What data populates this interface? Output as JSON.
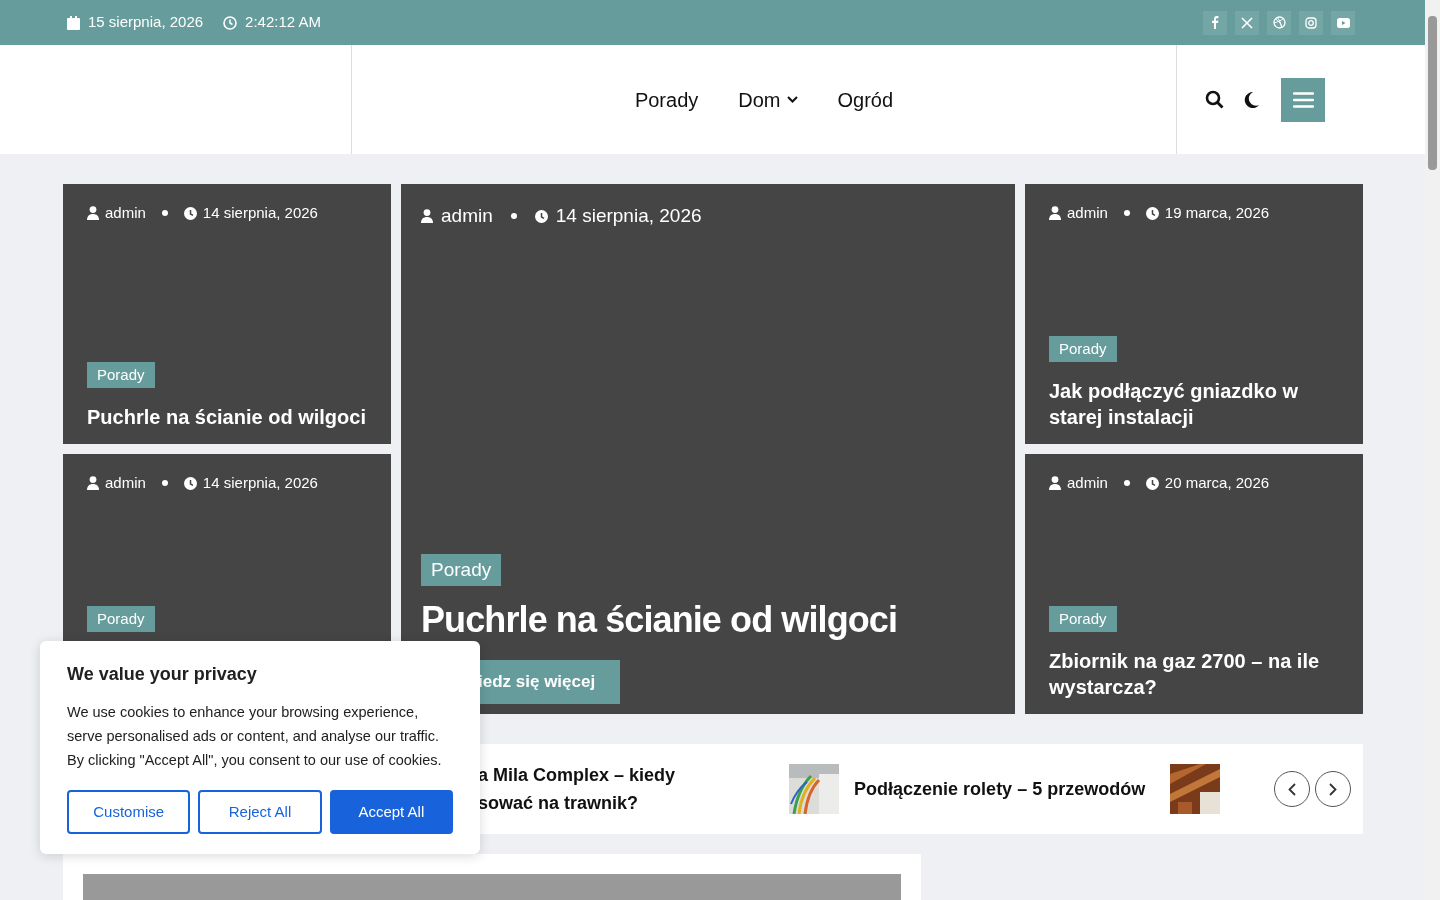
{
  "topbar": {
    "date": "15 sierpnia, 2026",
    "time": "2:42:12 AM"
  },
  "nav": [
    {
      "label": "Porady",
      "dropdown": false
    },
    {
      "label": "Dom",
      "dropdown": true
    },
    {
      "label": "Ogród",
      "dropdown": false
    }
  ],
  "cards": [
    {
      "kind": "small",
      "author": "admin",
      "date": "14 sierpnia, 2026",
      "category": "Porady",
      "title": "Puchrle na ścianie od wilgoci"
    },
    {
      "kind": "featured",
      "author": "admin",
      "date": "14 sierpnia, 2026",
      "category": "Porady",
      "title": "Puchrle na ścianie od wilgoci",
      "button": "iedz się więcej"
    },
    {
      "kind": "small",
      "author": "admin",
      "date": "19 marca, 2026",
      "category": "Porady",
      "title": "Jak podłączyć gniazdko w starej instalacji"
    },
    {
      "kind": "small",
      "author": "admin",
      "date": "14 sierpnia, 2026",
      "category": "Porady"
    },
    {
      "kind": "small",
      "author": "admin",
      "date": "20 marca, 2026",
      "category": "Porady",
      "title": "Zbiornik na gaz 2700 – na ile wystarcza?"
    }
  ],
  "ticker": [
    {
      "title_lines": [
        "a Mila Complex – kiedy",
        "sować na trawnik?"
      ]
    },
    {
      "kind": "picture",
      "title_lines": [
        "Podłączenie rolety – 5 przewodów"
      ]
    },
    {
      "kind": "picture"
    }
  ],
  "cookie": {
    "title": "We value your privacy",
    "text": "We use cookies to enhance your browsing experience, serve personalised ads or content, and analyse our traffic. By clicking \"Accept All\", you consent to our use of cookies.",
    "buttons": [
      {
        "label": "Customise",
        "kind": "outline"
      },
      {
        "label": "Reject All",
        "kind": "outline"
      },
      {
        "label": "Accept All",
        "kind": "primary"
      }
    ]
  }
}
